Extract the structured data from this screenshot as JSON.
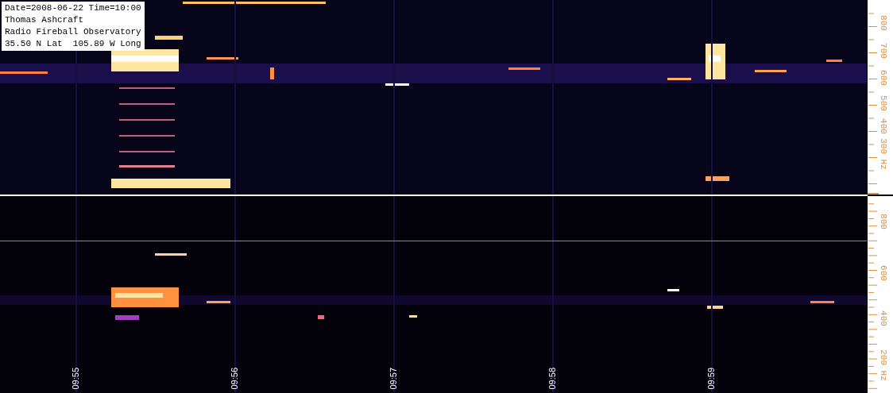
{
  "info_box": {
    "lines": [
      "Date=2008-06-22 Time=10:00",
      "Thomas Ashcraft",
      "Radio Fireball Observatory",
      "35.50 N Lat  105.89 W Long"
    ]
  },
  "panels": [
    {
      "axis_labels": [
        "800",
        "700",
        "600",
        "500",
        "400",
        "300 Hz"
      ]
    },
    {
      "axis_labels": [
        "800",
        "600",
        "400",
        "200 Hz"
      ]
    }
  ],
  "time_labels": [
    "09:55",
    "09:56",
    "09:57",
    "09:58",
    "09:59"
  ]
}
